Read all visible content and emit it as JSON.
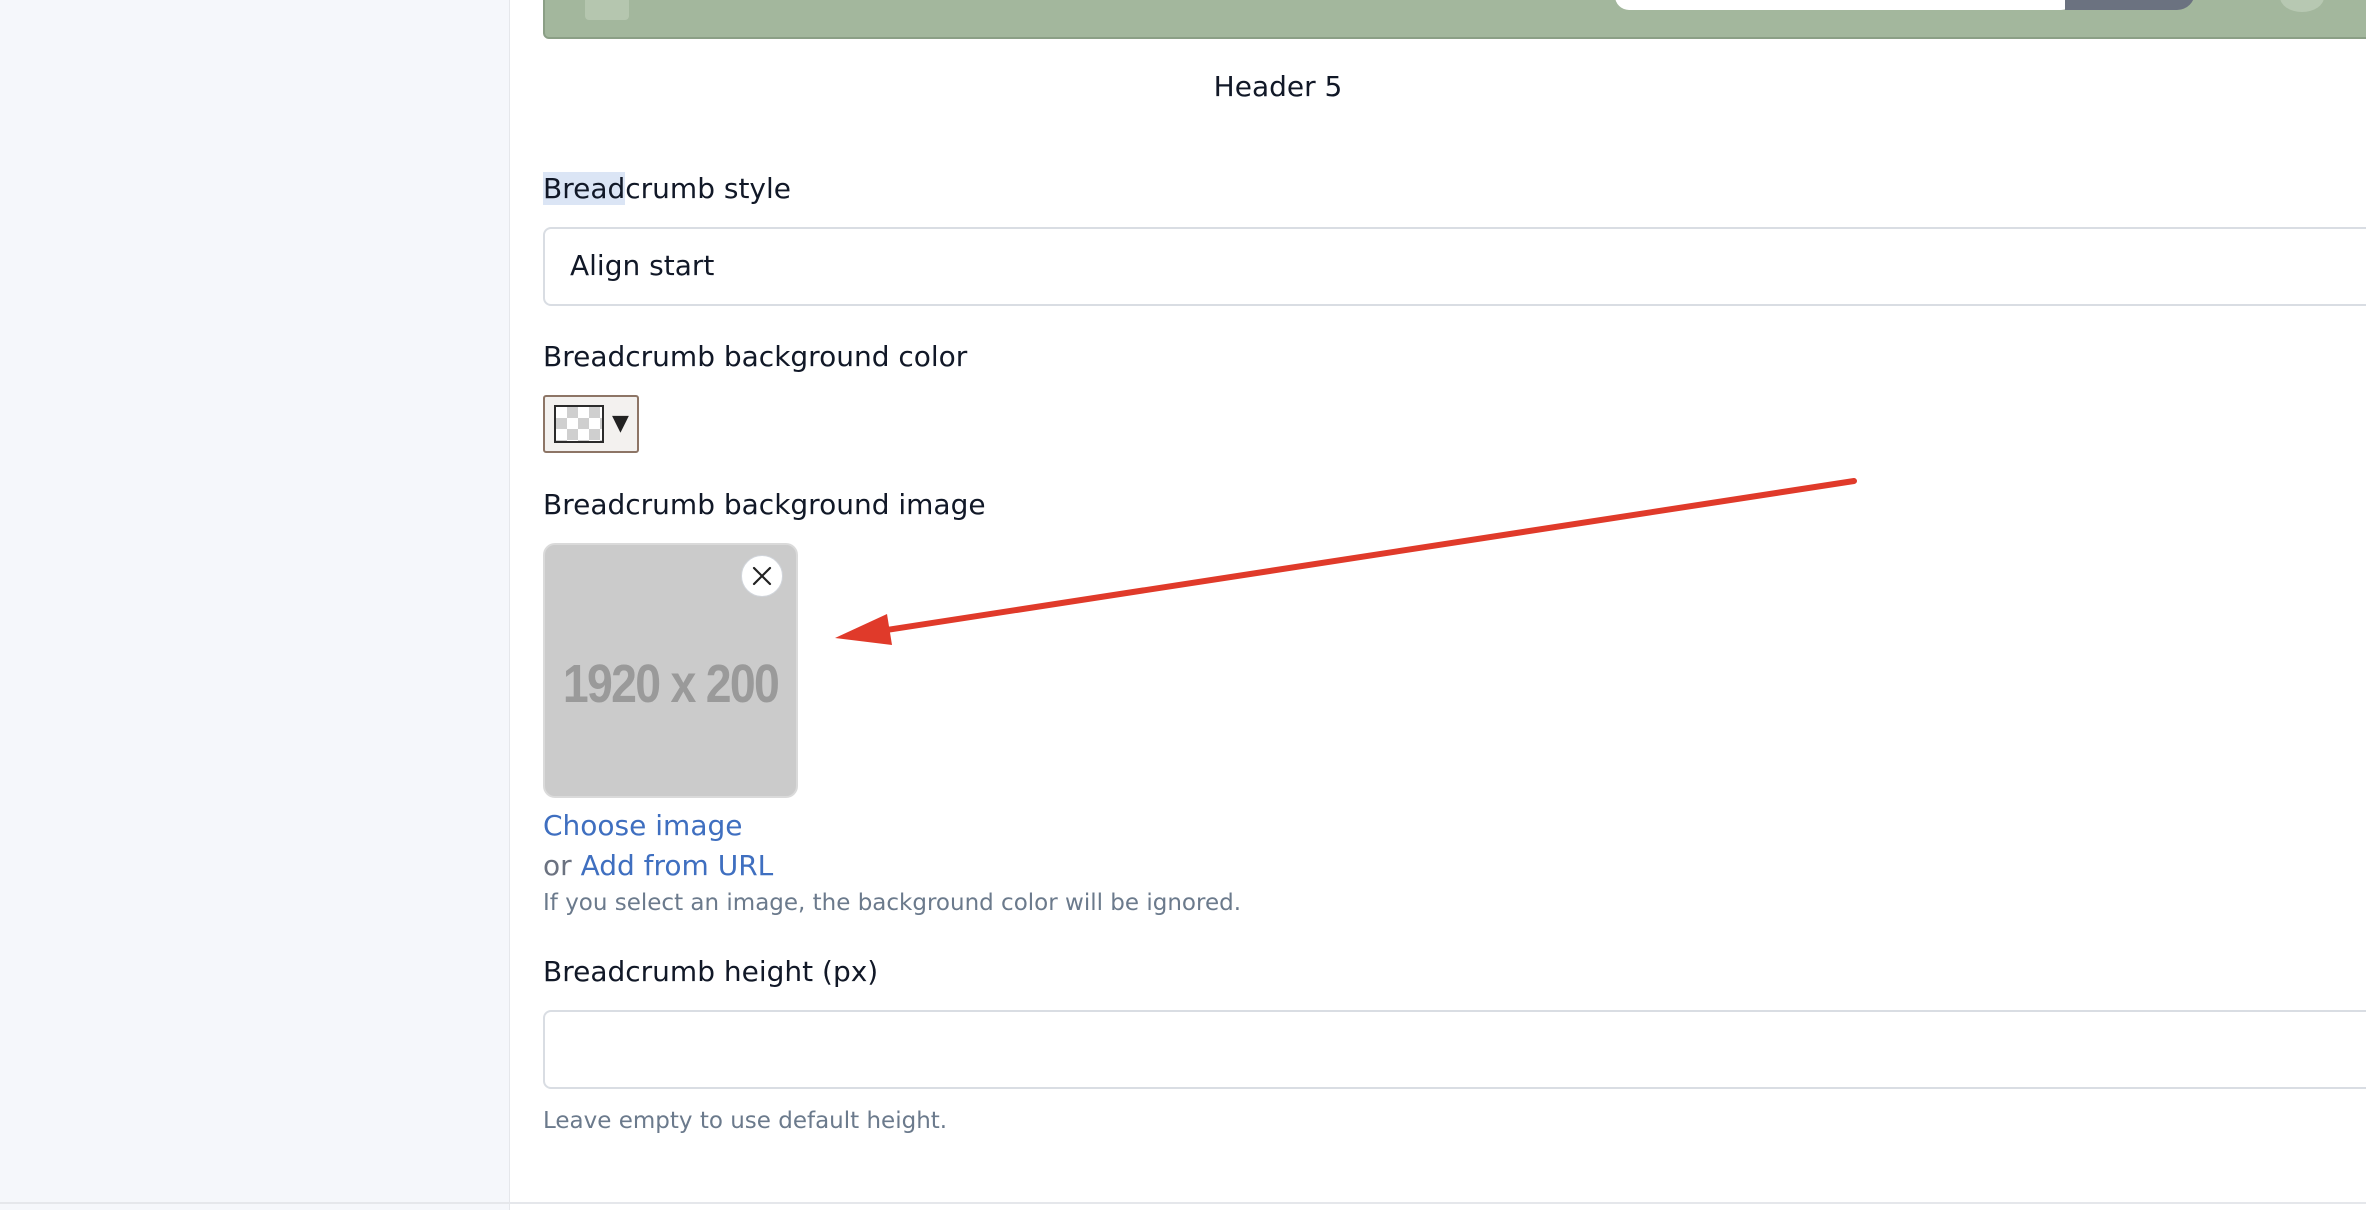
{
  "header_preview": {
    "caption": "Header 5"
  },
  "breadcrumb_style": {
    "label_highlighted": "Bread",
    "label_rest": "crumb style",
    "value": "Align start"
  },
  "breadcrumb_bg_color": {
    "label": "Breadcrumb background color",
    "caret": "▼"
  },
  "breadcrumb_bg_image": {
    "label": "Breadcrumb background image",
    "placeholder_text": "1920 x 200",
    "choose_link": "Choose image",
    "or_text": "or",
    "url_link": "Add from URL",
    "help": "If you select an image, the background color will be ignored."
  },
  "breadcrumb_height": {
    "label": "Breadcrumb height (px)",
    "value": "",
    "help": "Leave empty to use default height."
  },
  "colors": {
    "link": "#3f6fc0",
    "annotation_arrow": "#e03a2a",
    "header_preview_bg": "#a3b79d"
  },
  "icons": {
    "remove": "close-icon",
    "color_caret": "caret-down-icon"
  }
}
